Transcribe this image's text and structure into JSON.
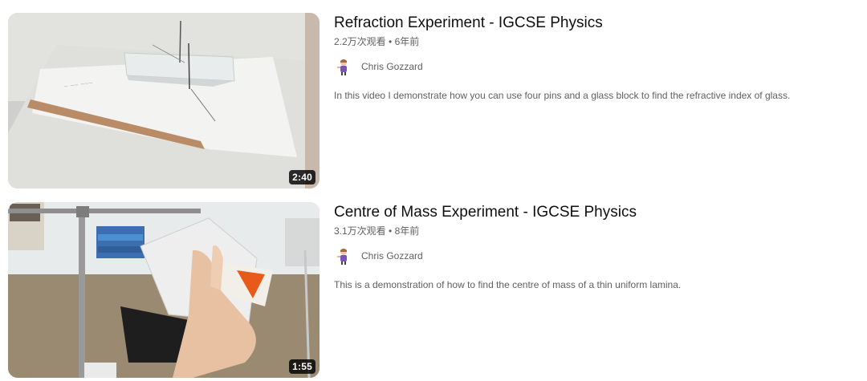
{
  "videos": [
    {
      "title": "Refraction Experiment - IGCSE Physics",
      "views": "2.2万次观看",
      "separator": " • ",
      "age": "6年前",
      "duration": "2:40",
      "channel": "Chris Gozzard",
      "description": "In this video I demonstrate how you can use four pins and a glass block to find the refractive index of glass."
    },
    {
      "title": "Centre of Mass Experiment - IGCSE Physics",
      "views": "3.1万次观看",
      "separator": " • ",
      "age": "8年前",
      "duration": "1:55",
      "channel": "Chris Gozzard",
      "description": "This is a demonstration of how to find the centre of mass of a thin uniform lamina."
    }
  ]
}
